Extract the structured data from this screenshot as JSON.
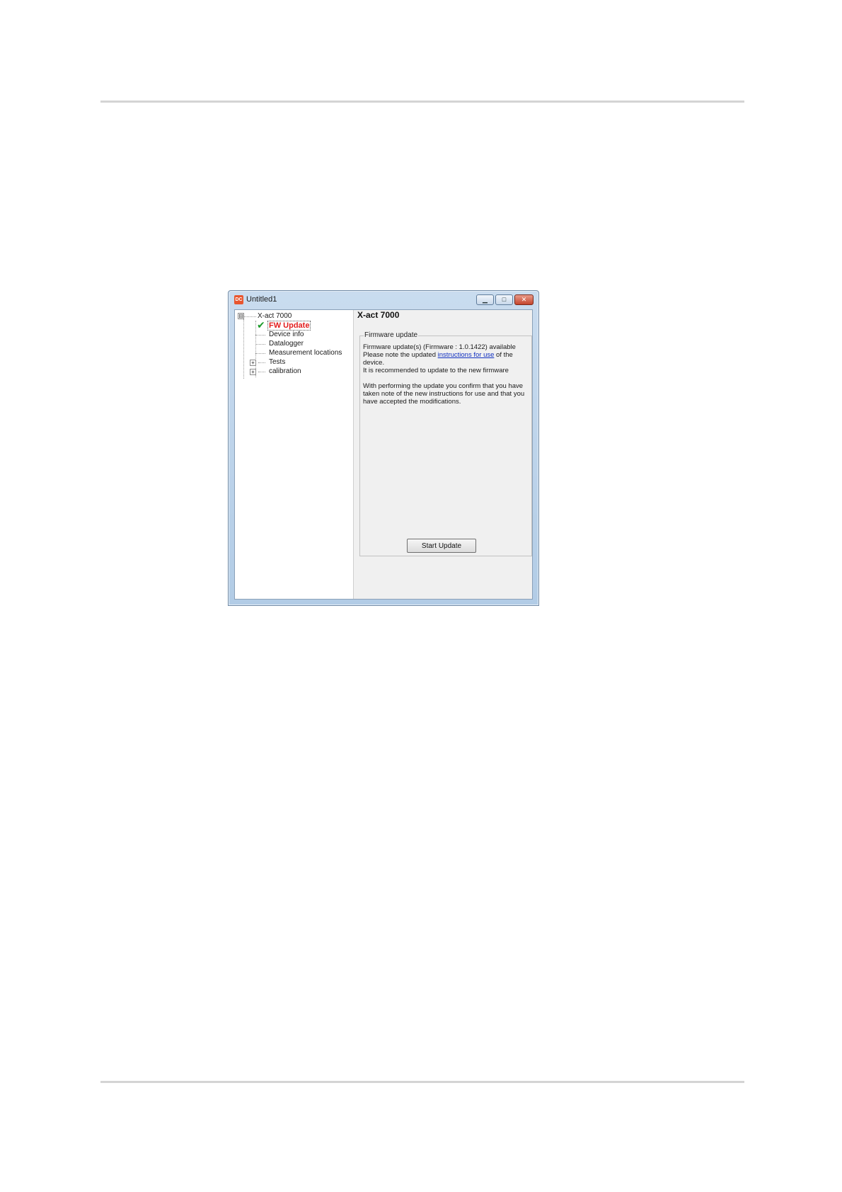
{
  "window": {
    "title": "Untitled1",
    "icon_text": "DC",
    "controls": {
      "minimize": "▁",
      "maximize": "□",
      "close": "✕"
    }
  },
  "tree": {
    "root": {
      "label": "X-act 7000",
      "expander": "⊟"
    },
    "items": [
      {
        "label": "FW Update",
        "selected": true,
        "icon": "checkmark-icon"
      },
      {
        "label": "Device info"
      },
      {
        "label": "Datalogger"
      },
      {
        "label": "Measurement locations"
      },
      {
        "label": "Tests",
        "expander": "+"
      },
      {
        "label": "calibration",
        "expander": "+"
      }
    ],
    "check_glyph": "✔"
  },
  "panel": {
    "title": "X-act 7000",
    "group": {
      "label": "Firmware update",
      "line1": "Firmware update(s) (Firmware : 1.0.1422) available",
      "line2_before": "Please note the updated ",
      "line2_link": "instructions for use",
      "line2_after": " of the",
      "line3": "device.",
      "line4": "It is recommended to update to the new firmware",
      "line5": "With performing the update you confirm that you have",
      "line6": "taken note of the new instructions for use and that you",
      "line7": "have accepted the modifications."
    },
    "start_button": "Start Update"
  },
  "colors": {
    "selected_text": "#e21c1c",
    "link": "#1030c0",
    "check": "#1d9b2a"
  }
}
